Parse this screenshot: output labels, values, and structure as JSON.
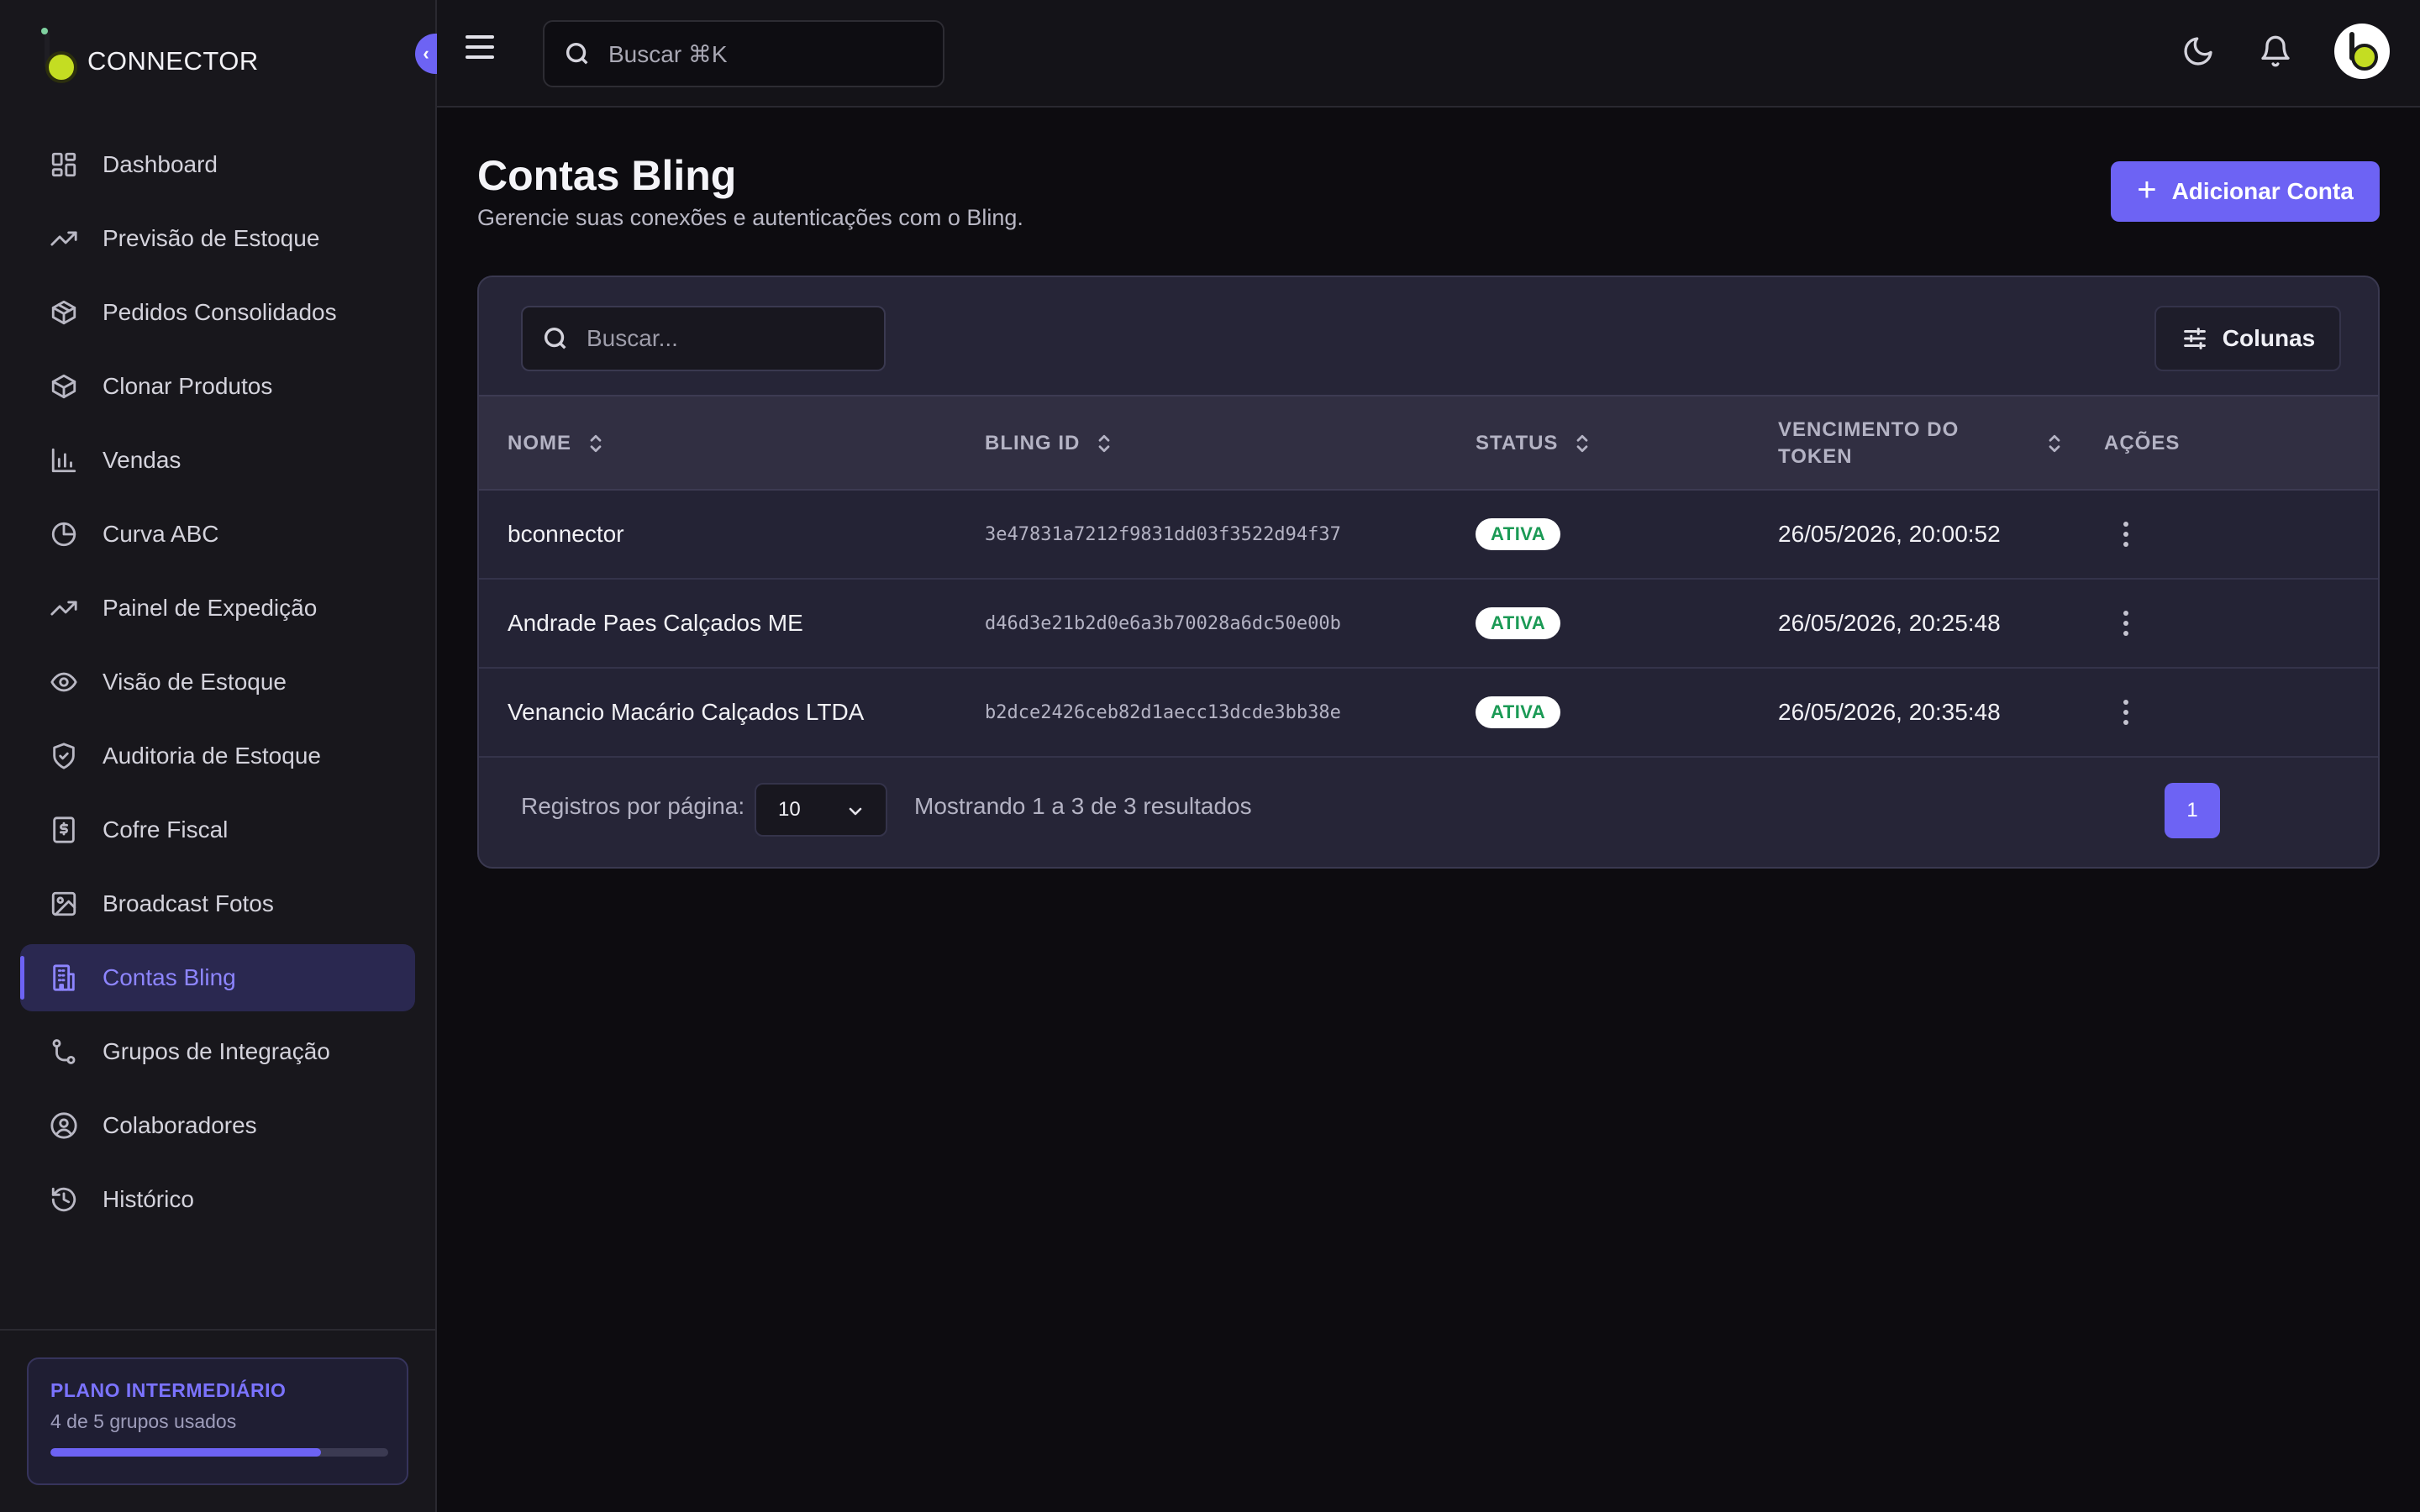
{
  "app": {
    "brand": "CONNECTOR"
  },
  "sidebar": {
    "items": [
      {
        "label": "Dashboard",
        "icon": "dashboard-icon",
        "active": false
      },
      {
        "label": "Previsão de Estoque",
        "icon": "trending-up-icon",
        "active": false
      },
      {
        "label": "Pedidos Consolidados",
        "icon": "package-icon",
        "active": false
      },
      {
        "label": "Clonar Produtos",
        "icon": "box-icon",
        "active": false
      },
      {
        "label": "Vendas",
        "icon": "bar-chart-icon",
        "active": false
      },
      {
        "label": "Curva ABC",
        "icon": "pie-chart-icon",
        "active": false
      },
      {
        "label": "Painel de Expedição",
        "icon": "trending-up-icon",
        "active": false
      },
      {
        "label": "Visão de Estoque",
        "icon": "eye-icon",
        "active": false
      },
      {
        "label": "Auditoria de Estoque",
        "icon": "shield-check-icon",
        "active": false
      },
      {
        "label": "Cofre Fiscal",
        "icon": "receipt-icon",
        "active": false
      },
      {
        "label": "Broadcast Fotos",
        "icon": "image-icon",
        "active": false
      },
      {
        "label": "Contas Bling",
        "icon": "building-icon",
        "active": true
      },
      {
        "label": "Grupos de Integração",
        "icon": "git-branch-icon",
        "active": false
      },
      {
        "label": "Colaboradores",
        "icon": "user-circle-icon",
        "active": false
      },
      {
        "label": "Histórico",
        "icon": "history-icon",
        "active": false
      }
    ],
    "plan": {
      "title": "PLANO INTERMEDIÁRIO",
      "usage": "4 de 5 grupos usados",
      "used": 4,
      "total": 5
    }
  },
  "topbar": {
    "search_placeholder": "Buscar ⌘K"
  },
  "main": {
    "title": "Contas Bling",
    "subtitle": "Gerencie suas conexões e autenticações com o Bling.",
    "add_button": "Adicionar Conta",
    "search_placeholder": "Buscar...",
    "columns_button": "Colunas",
    "columns": [
      "NOME",
      "BLING ID",
      "STATUS",
      "VENCIMENTO DO TOKEN",
      "AÇÕES"
    ],
    "rows": [
      {
        "name": "bconnector",
        "bling_id": "3e47831a7212f9831dd03f3522d94f37",
        "status": "ATIVA",
        "expires": "26/05/2026, 20:00:52"
      },
      {
        "name": "Andrade Paes Calçados ME",
        "bling_id": "d46d3e21b2d0e6a3b70028a6dc50e00b",
        "status": "ATIVA",
        "expires": "26/05/2026, 20:25:48"
      },
      {
        "name": "Venancio Macário Calçados LTDA",
        "bling_id": "b2dce2426ceb82d1aecc13dcde3bb38e",
        "status": "ATIVA",
        "expires": "26/05/2026, 20:35:48"
      }
    ],
    "pagination": {
      "per_page_label": "Registros por página:",
      "per_page_value": "10",
      "results_text": "Mostrando 1 a 3 de 3 resultados",
      "current_page": "1"
    }
  },
  "colors": {
    "accent": "#6d63f4",
    "status_active": "#1b9a55"
  }
}
